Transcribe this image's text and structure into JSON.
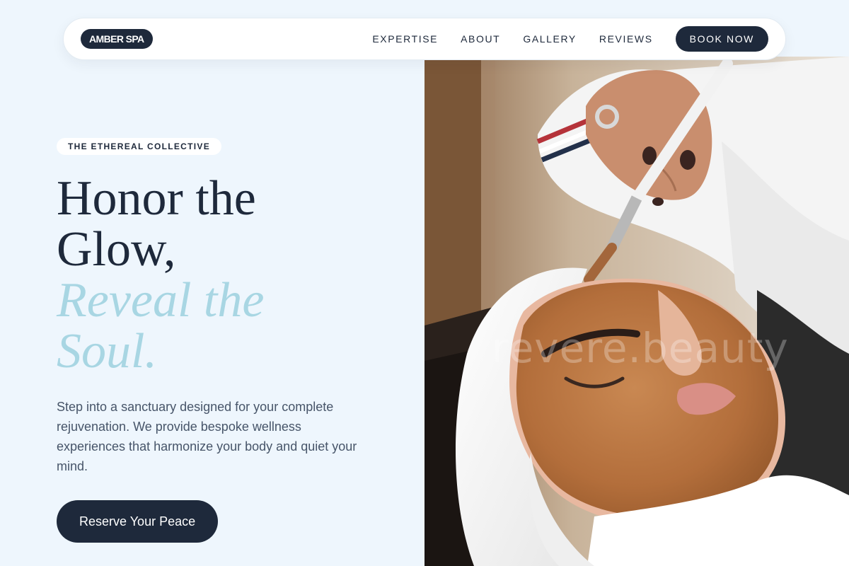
{
  "nav": {
    "logo": "AMBER SPA",
    "links": [
      {
        "label": "EXPERTISE"
      },
      {
        "label": "ABOUT"
      },
      {
        "label": "GALLERY"
      },
      {
        "label": "REVIEWS"
      }
    ],
    "book_label": "BOOK NOW"
  },
  "hero": {
    "tag": "THE ETHEREAL COLLECTIVE",
    "headline_line1": "Honor the",
    "headline_line2": "Glow,",
    "headline_accent1": "Reveal the",
    "headline_accent2": "Soul.",
    "description": "Step into a sanctuary designed for your complete rejuvenation. We provide bespoke wellness experiences that harmonize your body and quiet your mind.",
    "cta_label": "Reserve Your Peace",
    "watermark": "revere.beauty"
  },
  "colors": {
    "background": "#eef6fd",
    "primary_dark": "#1e293b",
    "accent_blue": "#a8d6e3",
    "body_text": "#475569"
  }
}
